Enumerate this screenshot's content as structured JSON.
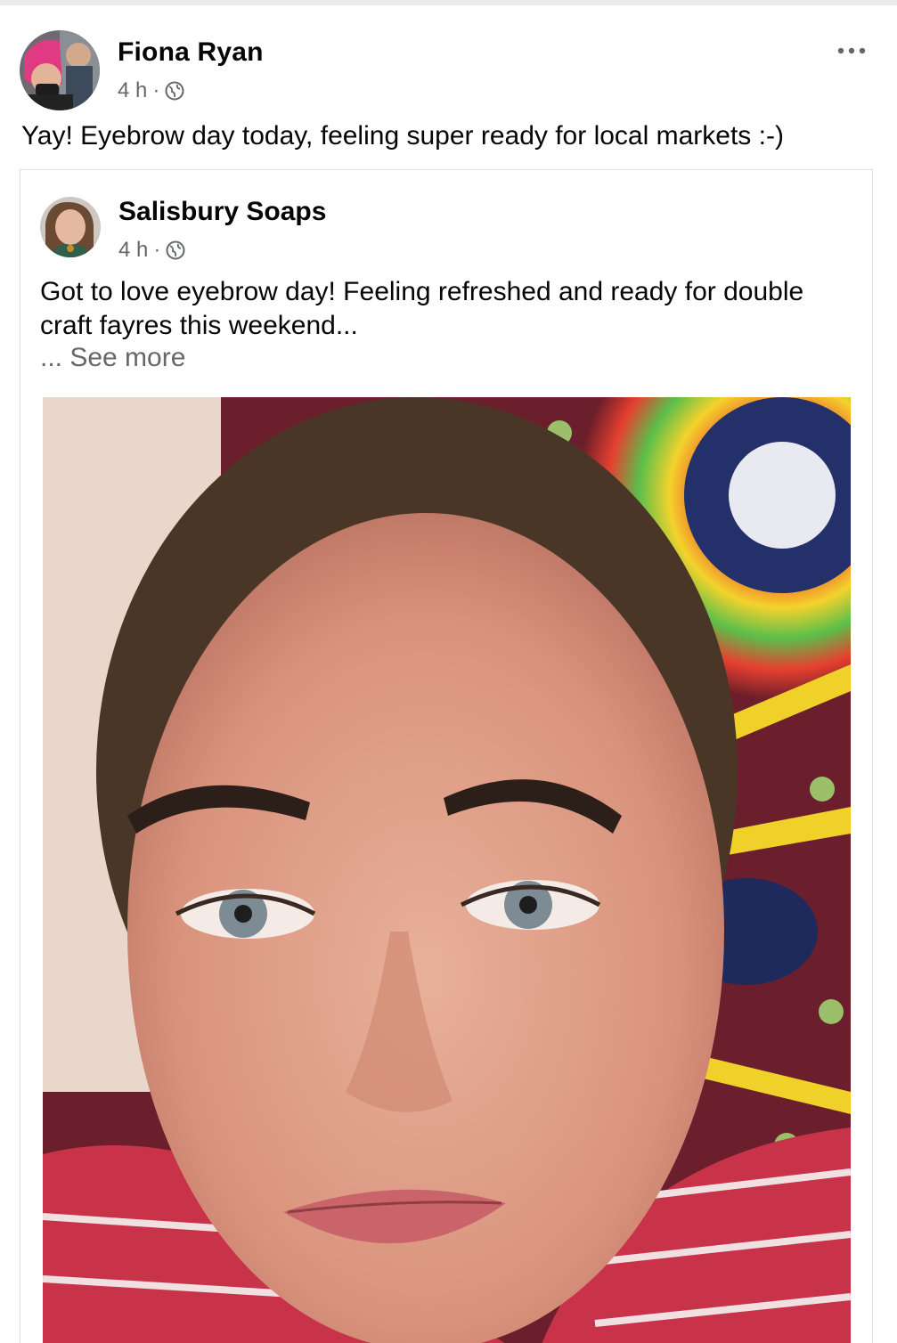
{
  "post": {
    "author": "Fiona Ryan",
    "time": "4 h",
    "separator": "·",
    "text": "Yay! Eyebrow day today, feeling super ready for local markets :-)",
    "more_icon": "more-horizontal-icon",
    "privacy_icon": "globe-icon"
  },
  "shared": {
    "author": "Salisbury Soaps",
    "time": "4 h",
    "separator": "·",
    "text": "Got to love eyebrow day! Feeling refreshed and ready for double craft fayres this weekend...",
    "see_more": "... See more",
    "privacy_icon": "globe-icon"
  },
  "colors": {
    "text_primary": "#050505",
    "text_secondary": "#65676b",
    "card_border": "#dddfe2"
  }
}
